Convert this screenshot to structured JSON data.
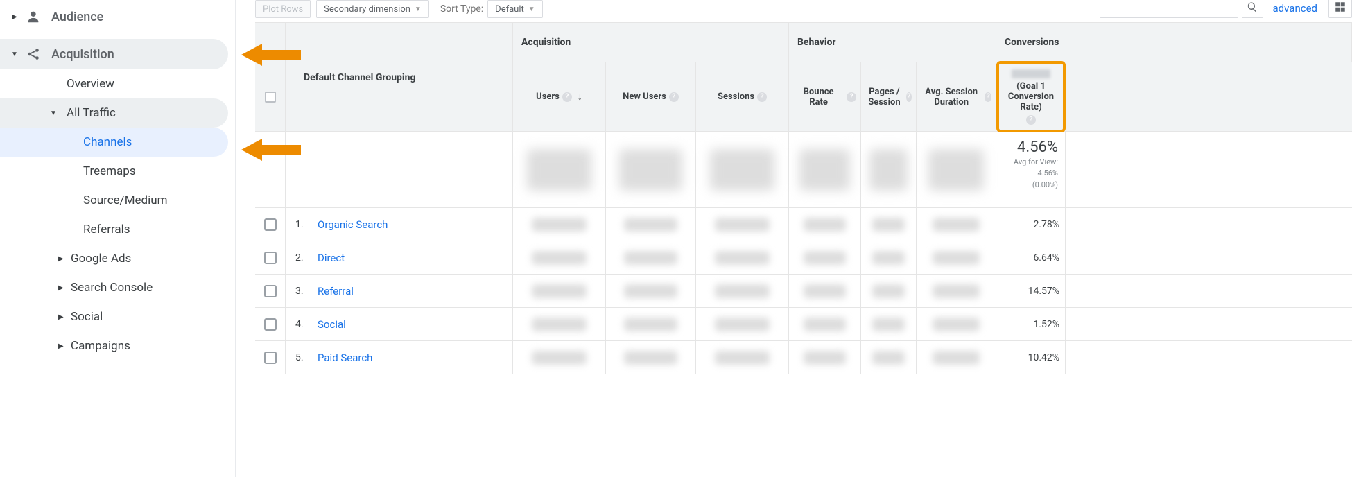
{
  "sidebar": {
    "audience_label": "Audience",
    "acquisition_label": "Acquisition",
    "acq_children": {
      "overview": "Overview",
      "all_traffic": "All Traffic",
      "all_traffic_children": {
        "channels": "Channels",
        "treemaps": "Treemaps",
        "source_medium": "Source/Medium",
        "referrals": "Referrals"
      },
      "google_ads": "Google Ads",
      "search_console": "Search Console",
      "social": "Social",
      "campaigns": "Campaigns"
    }
  },
  "toolbar": {
    "plot_rows": "Plot Rows",
    "secondary_dim": "Secondary dimension",
    "sort_type_label": "Sort Type:",
    "sort_type_value": "Default",
    "advanced": "advanced",
    "search_placeholder": ""
  },
  "table": {
    "dim_header": "Default Channel Grouping",
    "groups": {
      "acquisition": "Acquisition",
      "behavior": "Behavior",
      "conversions": "Conversions"
    },
    "metrics": {
      "users": "Users",
      "new_users": "New Users",
      "sessions": "Sessions",
      "bounce_rate": "Bounce Rate",
      "pps": "Pages / Session",
      "avg_dur": "Avg. Session Duration",
      "goal1": "(Goal 1 Conversion Rate)"
    },
    "summary": {
      "goal1_value": "4.56%",
      "goal1_sub1": "Avg for View:",
      "goal1_sub2": "4.56%",
      "goal1_sub3": "(0.00%)"
    },
    "rows": [
      {
        "n": "1.",
        "dim": "Organic Search",
        "goal1": "2.78%"
      },
      {
        "n": "2.",
        "dim": "Direct",
        "goal1": "6.64%"
      },
      {
        "n": "3.",
        "dim": "Referral",
        "goal1": "14.57%"
      },
      {
        "n": "4.",
        "dim": "Social",
        "goal1": "1.52%"
      },
      {
        "n": "5.",
        "dim": "Paid Search",
        "goal1": "10.42%"
      }
    ]
  }
}
